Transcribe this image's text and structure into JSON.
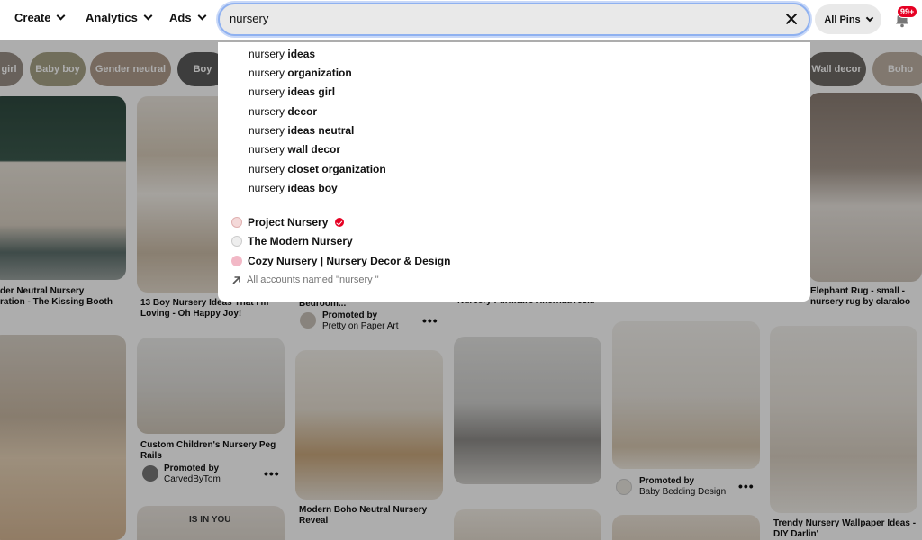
{
  "nav": {
    "create": "Create",
    "analytics": "Analytics",
    "ads": "Ads"
  },
  "search": {
    "value": "nursery",
    "scope": "All Pins"
  },
  "notifications": {
    "badge": "99+"
  },
  "chips": [
    {
      "label": "girl",
      "color": "#9a9087"
    },
    {
      "label": "Baby boy",
      "color": "#a7a286"
    },
    {
      "label": "Gender neutral",
      "color": "#b09c8d"
    },
    {
      "label": "Boy",
      "color": "#5a5a5a"
    },
    {
      "label": "Wall decor",
      "color": "#6f6a66"
    },
    {
      "label": "Boho",
      "color": "#bfb1a4"
    }
  ],
  "suggestions": [
    {
      "prefix": "nursery",
      "suffix": "ideas"
    },
    {
      "prefix": "nursery",
      "suffix": "organization"
    },
    {
      "prefix": "nursery",
      "suffix": "ideas girl"
    },
    {
      "prefix": "nursery",
      "suffix": "decor"
    },
    {
      "prefix": "nursery",
      "suffix": "ideas neutral"
    },
    {
      "prefix": "nursery",
      "suffix": "wall decor"
    },
    {
      "prefix": "nursery",
      "suffix": "closet organization"
    },
    {
      "prefix": "nursery",
      "suffix": "ideas boy"
    }
  ],
  "accounts": [
    {
      "name": "Project Nursery",
      "verified": true
    },
    {
      "name": "The Modern Nursery",
      "verified": false
    },
    {
      "name": "Cozy Nursery | Nursery Decor & Design",
      "verified": false
    }
  ],
  "all_accounts_text": "All accounts named \"nursery \"",
  "pins": {
    "p1_caption": "der Neutral Nursery\nration - The Kissing Booth",
    "p2_caption": "13 Boy Nursery Ideas That I'm Loving - Oh Happy Joy!",
    "p3_caption": "Bedroom...",
    "p3_promo_label": "Promoted by",
    "p3_promo_by": "Pretty on Paper Art",
    "p4_caption": "Nursery Furniture Alternatives...",
    "p6_caption": "Elephant Rug - small - nursery rug by claraloo",
    "p7_caption": "Custom Children's Nursery Peg Rails",
    "p7_promo_label": "Promoted by",
    "p7_promo_by": "CarvedByTom",
    "p8_caption": "Modern Boho Neutral Nursery Reveal",
    "p9_promo_label": "Promoted by",
    "p9_promo_by": "Baby Bedding Design",
    "p10_caption": "Trendy Nursery Wallpaper Ideas - DIY Darlin'",
    "p11_text": "IS IN YOU"
  }
}
